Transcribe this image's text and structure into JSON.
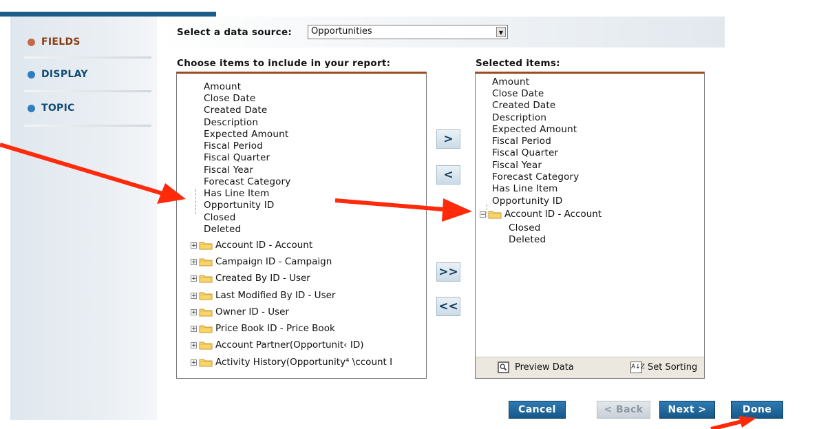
{
  "sidebar": {
    "items": [
      {
        "label": "FIELDS",
        "color": "#c66a45",
        "active": true
      },
      {
        "label": "DISPLAY",
        "color": "#2e7fc0",
        "active": false
      },
      {
        "label": "TOPIC",
        "color": "#2e7fc0",
        "active": false
      }
    ]
  },
  "source": {
    "label": "Select a data source:",
    "value": "Opportunities"
  },
  "left_panel": {
    "heading": "Choose items to include in your report:",
    "fields": [
      "Amount",
      "Close Date",
      "Created Date",
      "Description",
      "Expected Amount",
      "Fiscal Period",
      "Fiscal Quarter",
      "Fiscal Year",
      "Forecast Category",
      "Has Line Item",
      "Opportunity ID",
      "Closed",
      "Deleted"
    ],
    "folders": [
      "Account ID - Account",
      "Campaign ID - Campaign",
      "Created By ID - User",
      "Last Modified By ID - User",
      "Owner ID - User",
      "Price Book ID - Price Book",
      "Account Partner(Opportunit‹ ID)",
      "Activity History(Opportunity⁴ \\ccount I"
    ]
  },
  "right_panel": {
    "heading": "Selected items:",
    "fields": [
      "Amount",
      "Close Date",
      "Created Date",
      "Description",
      "Expected Amount",
      "Fiscal Period",
      "Fiscal Quarter",
      "Fiscal Year",
      "Forecast Category",
      "Has Line Item",
      "Opportunity ID"
    ],
    "folder": "Account ID - Account",
    "folder_children": [
      "Closed",
      "Deleted"
    ],
    "preview_label": "Preview Data",
    "sorting_label": "Set Sorting",
    "sorting_icon_text": "A↓Z"
  },
  "move_buttons": {
    "add": ">",
    "remove": "<",
    "add_all": ">>",
    "remove_all": "<<"
  },
  "wizard": {
    "cancel": "Cancel",
    "back": "< Back",
    "next": "Next >",
    "done": "Done"
  },
  "colors": {
    "accent": "#1b5d88",
    "panel_border": "#9c4a22",
    "arrow": "#ff2a0a"
  }
}
